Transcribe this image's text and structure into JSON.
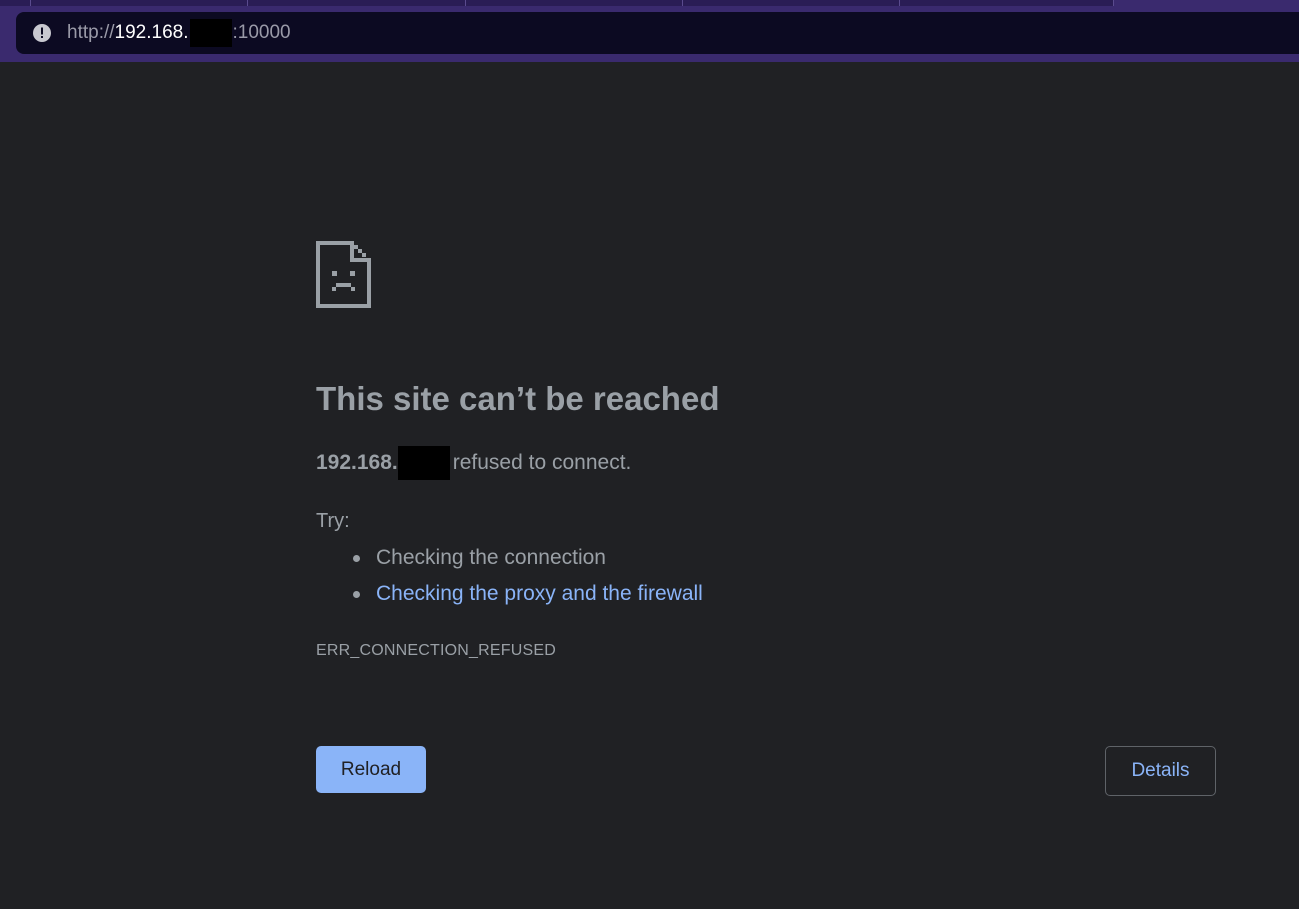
{
  "browser": {
    "address_bar": {
      "scheme": "http://",
      "host": "192.168.",
      "port": ":10000",
      "icon": "info-icon"
    }
  },
  "error_page": {
    "icon": "sad-file-icon",
    "title": "This site can’t be reached",
    "summary": {
      "host": "192.168.",
      "message": "refused to connect."
    },
    "try_label": "Try:",
    "suggestions": [
      {
        "text": "Checking the connection",
        "link": false
      },
      {
        "text": "Checking the proxy and the firewall",
        "link": true
      }
    ],
    "error_code": "ERR_CONNECTION_REFUSED",
    "reload_label": "Reload",
    "details_label": "Details"
  },
  "colors": {
    "background": "#202124",
    "text": "#9aa0a6",
    "link": "#8ab4f8",
    "accent_button": "#8ab4f8",
    "chrome": "#3a2a6e",
    "omnibox": "#0c0a22"
  }
}
